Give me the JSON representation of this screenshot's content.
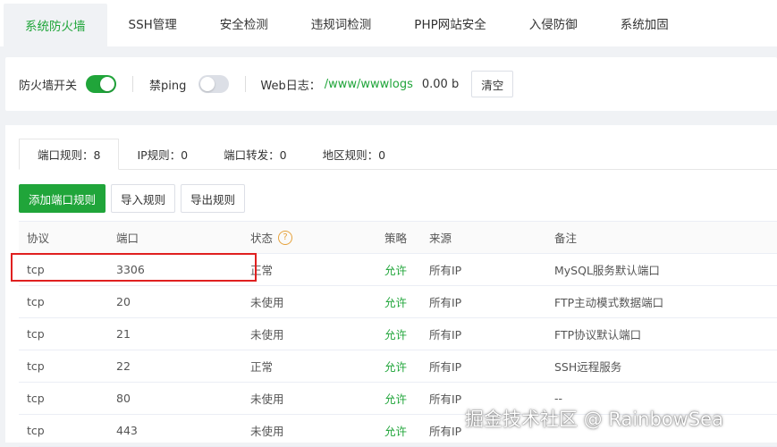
{
  "top_tabs": [
    {
      "label": "系统防火墙"
    },
    {
      "label": "SSH管理"
    },
    {
      "label": "安全检测"
    },
    {
      "label": "违规词检测"
    },
    {
      "label": "PHP网站安全"
    },
    {
      "label": "入侵防御"
    },
    {
      "label": "系统加固"
    }
  ],
  "toolbar": {
    "firewall_switch_label": "防火墙开关",
    "firewall_switch_on": true,
    "ping_label": "禁ping",
    "ping_switch_on": false,
    "weblog_label": "Web日志：",
    "weblog_path": "/www/wwwlogs",
    "weblog_size": "0.00 b",
    "clear_label": "清空"
  },
  "sub_tabs": [
    {
      "label": "端口规则：8"
    },
    {
      "label": "IP规则：0"
    },
    {
      "label": "端口转发：0"
    },
    {
      "label": "地区规则：0"
    }
  ],
  "actions": {
    "add_label": "添加端口规则",
    "import_label": "导入规则",
    "export_label": "导出规则"
  },
  "table": {
    "headers": {
      "protocol": "协议",
      "port": "端口",
      "status": "状态",
      "policy": "策略",
      "source": "来源",
      "remark": "备注"
    },
    "rows": [
      {
        "protocol": "tcp",
        "port": "3306",
        "status": "正常",
        "policy": "允许",
        "source": "所有IP",
        "remark": "MySQL服务默认端口"
      },
      {
        "protocol": "tcp",
        "port": "20",
        "status": "未使用",
        "policy": "允许",
        "source": "所有IP",
        "remark": "FTP主动模式数据端口"
      },
      {
        "protocol": "tcp",
        "port": "21",
        "status": "未使用",
        "policy": "允许",
        "source": "所有IP",
        "remark": "FTP协议默认端口"
      },
      {
        "protocol": "tcp",
        "port": "22",
        "status": "正常",
        "policy": "允许",
        "source": "所有IP",
        "remark": "SSH远程服务"
      },
      {
        "protocol": "tcp",
        "port": "80",
        "status": "未使用",
        "policy": "允许",
        "source": "所有IP",
        "remark": "--"
      },
      {
        "protocol": "tcp",
        "port": "443",
        "status": "未使用",
        "policy": "允许",
        "source": "所有IP",
        "remark": ""
      }
    ]
  },
  "watermark": "掘金技术社区 @ RainbowSea",
  "colors": {
    "accent": "#20a53a",
    "highlight": "#e02020",
    "help": "#e6a23c"
  }
}
